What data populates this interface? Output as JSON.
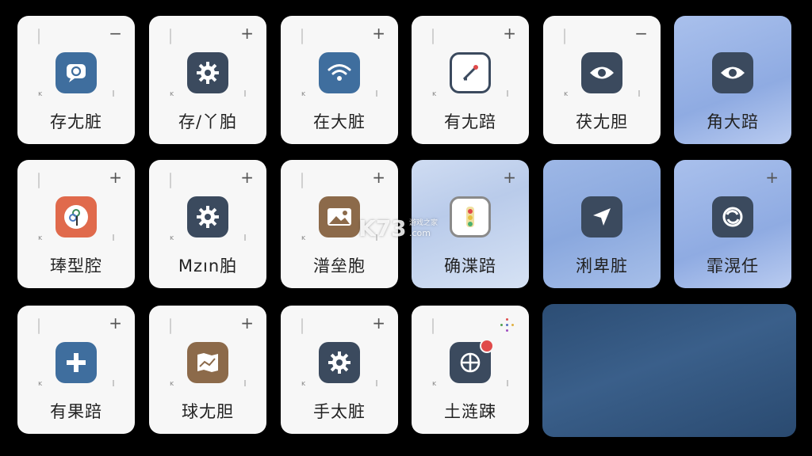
{
  "tiles": [
    {
      "label": "存尢脏",
      "corner": "−",
      "icon": "chat-icon",
      "tone": "white"
    },
    {
      "label": "存/丫胉",
      "corner": "+",
      "icon": "gear-icon",
      "tone": "white"
    },
    {
      "label": "在大脏",
      "corner": "+",
      "icon": "wifi-icon",
      "tone": "white"
    },
    {
      "label": "有尢踣",
      "corner": "+",
      "icon": "tool-icon",
      "tone": "white"
    },
    {
      "label": "茯尢胆",
      "corner": "−",
      "icon": "eye-icon",
      "tone": "white"
    },
    {
      "label": "角大踣",
      "corner": "",
      "icon": "eye-icon",
      "tone": "blue-deep"
    },
    {
      "label": "琫型腔",
      "corner": "+",
      "icon": "color-icon",
      "tone": "white"
    },
    {
      "label": "Mzın胉",
      "corner": "+",
      "icon": "gear-icon",
      "tone": "white"
    },
    {
      "label": "潽垒胞",
      "corner": "+",
      "icon": "image-icon",
      "tone": "white"
    },
    {
      "label": "确渫踣",
      "corner": "+",
      "icon": "traffic-icon",
      "tone": "blue-light"
    },
    {
      "label": "浰卑脏",
      "corner": "",
      "icon": "navigate-icon",
      "tone": "blue-mid"
    },
    {
      "label": "霏滉任",
      "corner": "+",
      "icon": "sync-icon",
      "tone": "blue-deep"
    },
    {
      "label": "有果踣",
      "corner": "+",
      "icon": "plus-icon",
      "tone": "white"
    },
    {
      "label": "球尢胆",
      "corner": "+",
      "icon": "map-icon",
      "tone": "white"
    },
    {
      "label": "手太脏",
      "corner": "+",
      "icon": "gear-icon",
      "tone": "white"
    },
    {
      "label": "土涟踈",
      "corner": "dots",
      "icon": "globe-icon",
      "tone": "white"
    }
  ],
  "watermark": {
    "brand": "K73",
    "sub": "游戏之家",
    "domain": ".com"
  },
  "colors": {
    "icon_blue": "#3f6e9e",
    "icon_dark": "#3b4a5e",
    "icon_red": "#e06a4c",
    "icon_brown": "#8c6a4a"
  }
}
